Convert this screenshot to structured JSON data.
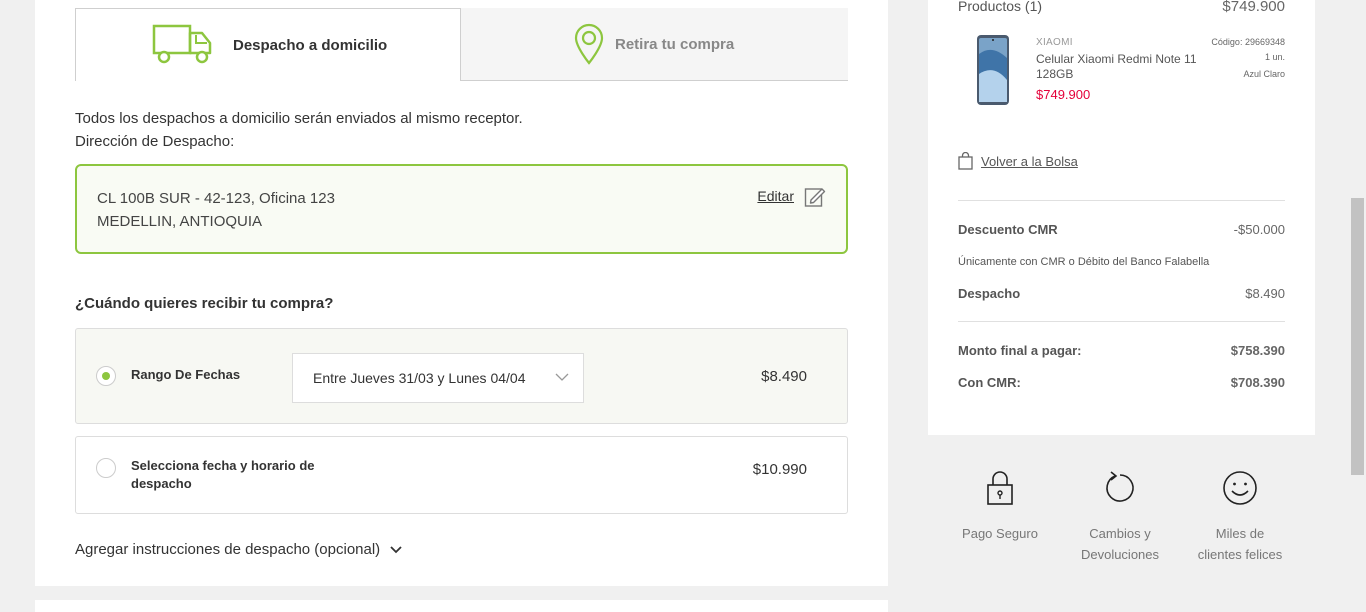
{
  "tabs": {
    "home_delivery": "Despacho a domicilio",
    "pickup": "Retira tu compra"
  },
  "delivery": {
    "info_line_1": "Todos los despachos a domicilio serán enviados al mismo receptor.",
    "info_line_2": "Dirección de Despacho:",
    "address_line_1": "CL 100B SUR - 42-123, Oficina 123",
    "address_line_2": "MEDELLIN, ANTIOQUIA",
    "edit_label": "Editar"
  },
  "schedule": {
    "question": "¿Cuándo quieres recibir tu compra?",
    "option_range_label": "Rango De Fechas",
    "option_range_select": "Entre Jueves 31/03 y Lunes 04/04",
    "option_range_price": "$8.490",
    "option_specific_label_1": "Selecciona fecha y horario de",
    "option_specific_label_2": "despacho",
    "option_specific_price": "$10.990"
  },
  "instructions": {
    "label": "Agregar instrucciones de despacho (opcional)"
  },
  "summary": {
    "products_label": "Productos (1)",
    "products_total": "$749.900",
    "product": {
      "brand": "XIAOMI",
      "name": "Celular Xiaomi Redmi Note 11 128GB",
      "price": "$749.900",
      "code": "Código: 29669348",
      "quantity": "1 un.",
      "color": "Azul Claro"
    },
    "back_link": "Volver a la Bolsa",
    "discount_label": "Descuento CMR",
    "discount_value": "-$50.000",
    "cmr_note": "Únicamente con CMR o Débito del Banco Falabella",
    "shipping_label": "Despacho",
    "shipping_value": "$8.490",
    "final_label": "Monto final a pagar:",
    "final_value": "$758.390",
    "cmr_label": "Con CMR:",
    "cmr_value": "$708.390"
  },
  "features": {
    "secure_payment": "Pago Seguro",
    "returns_1": "Cambios y",
    "returns_2": "Devoluciones",
    "happy_1": "Miles de",
    "happy_2": "clientes felices"
  },
  "colors": {
    "accent_green": "#8dc63f",
    "price_red": "#e4003a"
  }
}
